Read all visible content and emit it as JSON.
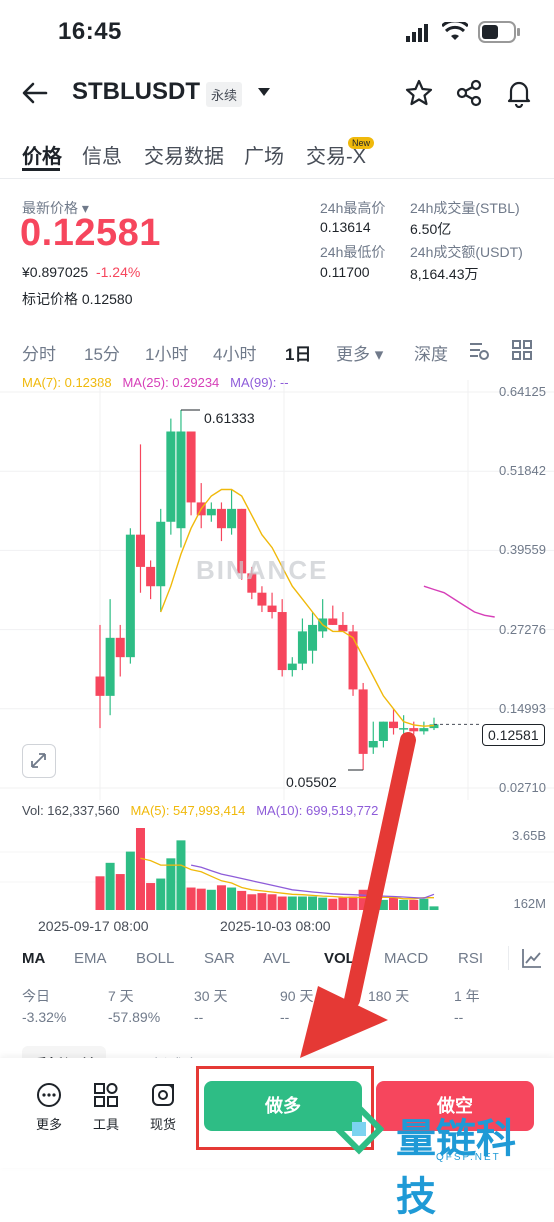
{
  "status_bar": {
    "time": "16:45"
  },
  "header": {
    "symbol": "STBLUSDT",
    "contract_type": "永续"
  },
  "tabs": [
    {
      "label": "价格"
    },
    {
      "label": "信息"
    },
    {
      "label": "交易数据"
    },
    {
      "label": "广场"
    },
    {
      "label": "交易-X"
    }
  ],
  "new_badge": "New",
  "ticker": {
    "last_price_label": "最新价格",
    "last_price": "0.12581",
    "cny_price": "¥0.897025",
    "change_pct": "-1.24%",
    "mark_price_label": "标记价格",
    "mark_price": "0.12580",
    "high_24h_label": "24h最高价",
    "high_24h": "0.13614",
    "low_24h_label": "24h最低价",
    "low_24h": "0.11700",
    "vol_stbl_label": "24h成交量(STBL)",
    "vol_stbl": "6.50亿",
    "vol_usdt_label": "24h成交额(USDT)",
    "vol_usdt": "8,164.43万"
  },
  "intervals": [
    {
      "label": "分时"
    },
    {
      "label": "15分"
    },
    {
      "label": "1小时"
    },
    {
      "label": "4小时"
    },
    {
      "label": "1日"
    },
    {
      "label": "更多"
    },
    {
      "label": "深度"
    }
  ],
  "ma_legend": {
    "ma7": "MA(7): 0.12388",
    "ma25": "MA(25): 0.29234",
    "ma99": "MA(99): --"
  },
  "watermark": "BINANCE",
  "annotations": {
    "high": "0.61333",
    "low": "0.05502",
    "current": "0.12581"
  },
  "vol_legend": {
    "vol": "Vol: 162,337,560",
    "ma5": "MA(5): 547,993,414",
    "ma10": "MA(10): 699,519,772",
    "vol_max": "3.65B",
    "vol_min": "162M"
  },
  "date_labels": [
    "2025-09-17 08:00",
    "2025-10-03 08:00"
  ],
  "indicators": [
    {
      "label": "MA"
    },
    {
      "label": "EMA"
    },
    {
      "label": "BOLL"
    },
    {
      "label": "SAR"
    },
    {
      "label": "AVL"
    },
    {
      "label": "VOL"
    },
    {
      "label": "MACD"
    },
    {
      "label": "RSI"
    }
  ],
  "performance": [
    {
      "label": "今日",
      "value": "-3.32%"
    },
    {
      "label": "7 天",
      "value": "-57.89%"
    },
    {
      "label": "30 天",
      "value": "--"
    },
    {
      "label": "90 天",
      "value": "--"
    },
    {
      "label": "180 天",
      "value": "--"
    },
    {
      "label": "1 年",
      "value": "--"
    }
  ],
  "order_tabs": {
    "open_orders": "委托订单",
    "latest_trades": "最新成交"
  },
  "bottom_tools": [
    {
      "label": "更多"
    },
    {
      "label": "工具"
    },
    {
      "label": "现货"
    }
  ],
  "actions": {
    "long": "做多",
    "short": "做空"
  },
  "brand_watermark": {
    "name": "量链科技",
    "domain": "QFSP.NET"
  },
  "colors": {
    "up": "#2ebd85",
    "down": "#f6465d",
    "ma7": "#f0b90b",
    "ma25": "#d63fb8",
    "ma10": "#8e5cd9"
  },
  "chart_data": {
    "type": "candlestick",
    "y_ticks": [
      "0.64125",
      "0.51842",
      "0.39559",
      "0.27276",
      "0.14993",
      "0.02710"
    ],
    "ylim": [
      0.0271,
      0.64125
    ],
    "candles": [
      {
        "o": 0.2,
        "h": 0.28,
        "l": 0.12,
        "c": 0.17
      },
      {
        "o": 0.17,
        "h": 0.32,
        "l": 0.14,
        "c": 0.26
      },
      {
        "o": 0.26,
        "h": 0.28,
        "l": 0.2,
        "c": 0.23
      },
      {
        "o": 0.23,
        "h": 0.43,
        "l": 0.22,
        "c": 0.42
      },
      {
        "o": 0.42,
        "h": 0.56,
        "l": 0.33,
        "c": 0.37
      },
      {
        "o": 0.37,
        "h": 0.38,
        "l": 0.32,
        "c": 0.34
      },
      {
        "o": 0.34,
        "h": 0.46,
        "l": 0.3,
        "c": 0.44
      },
      {
        "o": 0.44,
        "h": 0.6,
        "l": 0.42,
        "c": 0.58
      },
      {
        "o": 0.43,
        "h": 0.61333,
        "l": 0.4,
        "c": 0.58
      },
      {
        "o": 0.58,
        "h": 0.58,
        "l": 0.45,
        "c": 0.47
      },
      {
        "o": 0.47,
        "h": 0.5,
        "l": 0.43,
        "c": 0.45
      },
      {
        "o": 0.45,
        "h": 0.47,
        "l": 0.44,
        "c": 0.46
      },
      {
        "o": 0.46,
        "h": 0.47,
        "l": 0.41,
        "c": 0.43
      },
      {
        "o": 0.43,
        "h": 0.49,
        "l": 0.42,
        "c": 0.46
      },
      {
        "o": 0.46,
        "h": 0.46,
        "l": 0.35,
        "c": 0.36
      },
      {
        "o": 0.36,
        "h": 0.37,
        "l": 0.32,
        "c": 0.33
      },
      {
        "o": 0.33,
        "h": 0.34,
        "l": 0.3,
        "c": 0.31
      },
      {
        "o": 0.31,
        "h": 0.33,
        "l": 0.29,
        "c": 0.3
      },
      {
        "o": 0.3,
        "h": 0.32,
        "l": 0.2,
        "c": 0.21
      },
      {
        "o": 0.21,
        "h": 0.23,
        "l": 0.2,
        "c": 0.22
      },
      {
        "o": 0.22,
        "h": 0.29,
        "l": 0.21,
        "c": 0.27
      },
      {
        "o": 0.24,
        "h": 0.3,
        "l": 0.22,
        "c": 0.28
      },
      {
        "o": 0.27,
        "h": 0.32,
        "l": 0.26,
        "c": 0.29
      },
      {
        "o": 0.29,
        "h": 0.31,
        "l": 0.28,
        "c": 0.28
      },
      {
        "o": 0.28,
        "h": 0.3,
        "l": 0.27,
        "c": 0.27
      },
      {
        "o": 0.27,
        "h": 0.28,
        "l": 0.17,
        "c": 0.18
      },
      {
        "o": 0.18,
        "h": 0.19,
        "l": 0.05502,
        "c": 0.08
      },
      {
        "o": 0.09,
        "h": 0.13,
        "l": 0.08,
        "c": 0.1
      },
      {
        "o": 0.1,
        "h": 0.13,
        "l": 0.09,
        "c": 0.13
      },
      {
        "o": 0.13,
        "h": 0.15,
        "l": 0.11,
        "c": 0.12
      },
      {
        "o": 0.12,
        "h": 0.14,
        "l": 0.11,
        "c": 0.12
      },
      {
        "o": 0.12,
        "h": 0.13,
        "l": 0.11,
        "c": 0.115
      },
      {
        "o": 0.115,
        "h": 0.13,
        "l": 0.11,
        "c": 0.12
      },
      {
        "o": 0.12,
        "h": 0.13614,
        "l": 0.117,
        "c": 0.12581
      }
    ],
    "ma7": [
      null,
      null,
      null,
      null,
      null,
      null,
      0.3,
      0.34,
      0.39,
      0.43,
      0.46,
      0.48,
      0.49,
      0.49,
      0.48,
      0.45,
      0.42,
      0.4,
      0.37,
      0.34,
      0.32,
      0.3,
      0.28,
      0.27,
      0.27,
      0.26,
      0.23,
      0.2,
      0.17,
      0.15,
      0.13,
      0.125,
      0.123,
      0.12388
    ],
    "ma25": [
      null,
      null,
      null,
      null,
      null,
      null,
      null,
      null,
      null,
      null,
      null,
      null,
      null,
      null,
      null,
      null,
      null,
      null,
      null,
      null,
      null,
      null,
      null,
      null,
      0.34,
      0.335,
      0.33,
      0.32,
      0.31,
      0.3,
      0.295,
      0.29234,
      null,
      null
    ],
    "volume": [
      1.5,
      2.1,
      1.6,
      2.6,
      3.65,
      1.2,
      1.4,
      2.3,
      3.1,
      1.0,
      0.95,
      0.9,
      1.1,
      1.0,
      0.85,
      0.7,
      0.75,
      0.7,
      0.6,
      0.6,
      0.6,
      0.6,
      0.55,
      0.5,
      0.55,
      0.6,
      0.9,
      0.5,
      0.45,
      0.55,
      0.45,
      0.45,
      0.5,
      0.162
    ],
    "vol_ma5": [
      null,
      null,
      null,
      null,
      2.3,
      2.2,
      2.0,
      2.0,
      2.0,
      1.8,
      1.7,
      1.5,
      1.3,
      1.2,
      1.0,
      0.9,
      0.85,
      0.8,
      0.75,
      0.7,
      0.68,
      0.65,
      0.62,
      0.6,
      0.57,
      0.56,
      0.55,
      0.55,
      0.56,
      0.56,
      0.5,
      0.5,
      0.55,
      0.548
    ],
    "vol_ma10": [
      null,
      null,
      null,
      null,
      null,
      null,
      null,
      null,
      null,
      2.0,
      1.9,
      1.75,
      1.6,
      1.5,
      1.4,
      1.3,
      1.2,
      1.1,
      1.0,
      0.9,
      0.85,
      0.8,
      0.76,
      0.72,
      0.7,
      0.68,
      0.66,
      0.64,
      0.62,
      0.6,
      0.58,
      0.55,
      0.53,
      0.7
    ]
  }
}
